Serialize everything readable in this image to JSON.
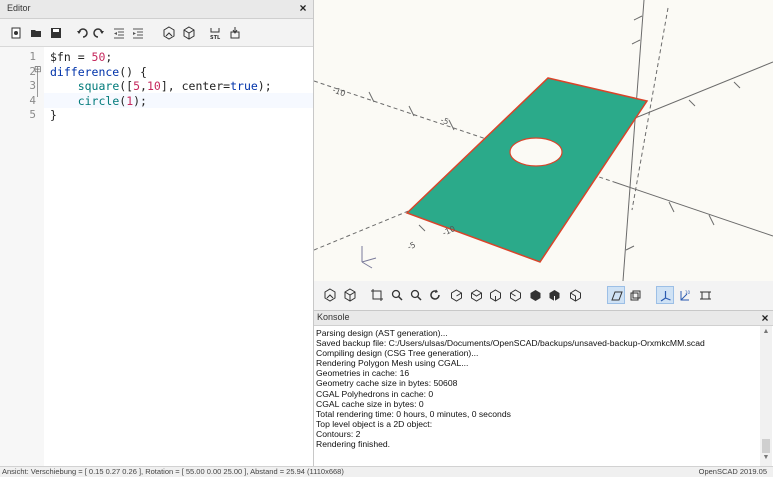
{
  "editor": {
    "title": "Editor",
    "close": "×",
    "lines": [
      {
        "n": "1",
        "parts": [
          [
            "",
            "$fn = "
          ],
          [
            "num",
            "50"
          ],
          [
            "",
            ";"
          ]
        ]
      },
      {
        "n": "2",
        "parts": [
          [
            "kw",
            "difference"
          ],
          [
            "",
            "() {"
          ]
        ]
      },
      {
        "n": "3",
        "parts": [
          [
            "",
            "    "
          ],
          [
            "fn",
            "square"
          ],
          [
            "",
            "(["
          ],
          [
            "num",
            "5"
          ],
          [
            "",
            ","
          ],
          [
            "num",
            "10"
          ],
          [
            "",
            "], center="
          ],
          [
            "kw",
            "true"
          ],
          [
            "",
            ");"
          ]
        ]
      },
      {
        "n": "4",
        "parts": [
          [
            "",
            "    "
          ],
          [
            "fn",
            "circle"
          ],
          [
            "",
            "("
          ],
          [
            "num",
            "1"
          ],
          [
            "",
            ");"
          ]
        ]
      },
      {
        "n": "5",
        "parts": [
          [
            "",
            "}"
          ]
        ]
      }
    ]
  },
  "console": {
    "title": "Konsole",
    "close": "×",
    "lines": [
      "Parsing design (AST generation)...",
      "Saved backup file: C:/Users/ulsas/Documents/OpenSCAD/backups/unsaved-backup-OrxmkcMM.scad",
      "Compiling design (CSG Tree generation)...",
      "Rendering Polygon Mesh using CGAL...",
      "Geometries in cache: 16",
      "Geometry cache size in bytes: 50608",
      "CGAL Polyhedrons in cache: 0",
      "CGAL cache size in bytes: 0",
      "Total rendering time: 0 hours, 0 minutes, 0 seconds",
      "Top level object is a 2D object:",
      "Contours: 2",
      "Rendering finished."
    ]
  },
  "viewport": {
    "axis_labels": [
      "-10",
      "-5",
      "-10",
      "-5"
    ],
    "shape_color": "#2baa8a",
    "edge_color": "#d9442a"
  },
  "statusbar": {
    "left": "Ansicht: Verschiebung = [ 0.15 0.27 0.26 ], Rotation = [ 55.00 0.00 25.00 ], Abstand = 25.94 (1110x668)",
    "right": "OpenSCAD 2019.05"
  }
}
